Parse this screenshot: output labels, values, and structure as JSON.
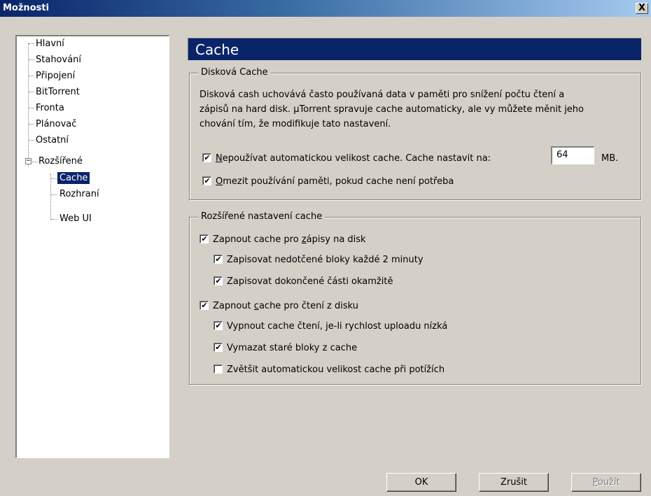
{
  "window": {
    "title": "Možnosti",
    "close_label": "X"
  },
  "sidebar": {
    "items": [
      {
        "label": "Hlavní"
      },
      {
        "label": "Stahování"
      },
      {
        "label": "Připojení"
      },
      {
        "label": "BitTorrent"
      },
      {
        "label": "Fronta"
      },
      {
        "label": "Plánovač"
      },
      {
        "label": "Ostatní"
      },
      {
        "label": "Rozšířené",
        "expanded": true,
        "expander": "−"
      },
      {
        "label": "Cache",
        "selected": true
      },
      {
        "label": "Rozhraní"
      },
      {
        "label": "Web UI"
      }
    ]
  },
  "page": {
    "title": "Cache"
  },
  "disk_cache": {
    "legend": "Disková Cache",
    "description_lines": [
      "Disková cash uchovává často používaná data v paměti pro snížení počtu čtení a",
      "zápisů na hard disk. µTorrent spravuje cache automaticky, ale vy můžete měnit jeho",
      "chování tím, že modifikuje tato nastavení."
    ],
    "override_size": {
      "mnemonic": "N",
      "label_rest": "epoužívat automatickou velikost cache. Cache nastavit na:",
      "checked": true,
      "value": "64",
      "unit": "MB."
    },
    "reduce_memory": {
      "mnemonic": "O",
      "label_rest": "mezit používání paměti, pokud cache není potřeba",
      "checked": true
    }
  },
  "advanced_cache": {
    "legend": "Rozšířené nastavení cache",
    "write_cache": {
      "label_before": "Zapnout cache pro ",
      "mnemonic": "z",
      "label_after": "ápisy na disk",
      "checked": true
    },
    "write_untouched": {
      "label": "Zapisovat nedotčené bloky každé 2 minuty",
      "checked": true
    },
    "write_finished": {
      "label": "Zapisovat dokončené části okamžitě",
      "checked": true
    },
    "read_cache": {
      "label_before": "Zapnout ",
      "mnemonic": "c",
      "label_after": "ache pro čtení z disku",
      "checked": true
    },
    "disable_read_slow": {
      "label": "Vypnout cache čtení, je-li rychlost uploadu nízká",
      "checked": true
    },
    "purge_old": {
      "label": "Vymazat staré bloky z cache",
      "checked": true
    },
    "grow_on_thrash": {
      "label": "Zvětšit automatickou velikost cache při potížích",
      "checked": false
    }
  },
  "buttons": {
    "ok": "OK",
    "cancel": "Zrušit",
    "apply_mnemonic": "P",
    "apply_rest": "oužít"
  }
}
